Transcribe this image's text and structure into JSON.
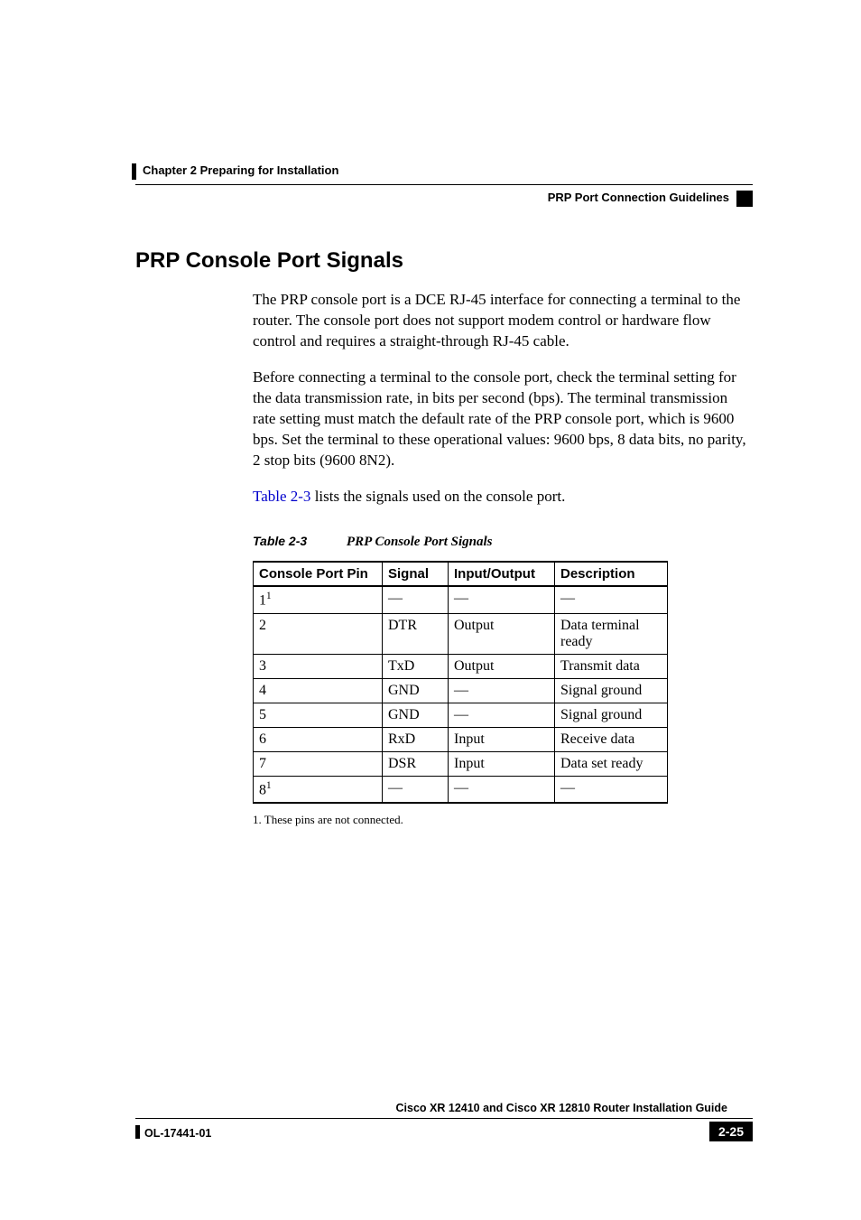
{
  "header": {
    "chapter": "Chapter 2      Preparing for Installation",
    "section": "PRP Port Connection Guidelines"
  },
  "title": "PRP Console Port Signals",
  "paragraphs": {
    "p1": "The PRP console port is a DCE RJ-45 interface for connecting a terminal to the router. The console port does not support modem control or hardware flow control and requires a straight-through RJ-45 cable.",
    "p2": "Before connecting a terminal to the console port, check the terminal setting for the data transmission rate, in bits per second (bps). The terminal transmission rate setting must match the default rate of the PRP console port, which is 9600 bps. Set the terminal to these operational values: 9600 bps, 8 data bits, no parity, 2 stop bits (9600 8N2).",
    "p3a": "Table 2-3",
    "p3b": " lists the signals used on the console port."
  },
  "table": {
    "caption_ref": "Table 2-3",
    "caption_title": "PRP Console Port Signals",
    "headers": {
      "c1": "Console Port Pin",
      "c2": "Signal",
      "c3": "Input/Output",
      "c4": "Description"
    },
    "rows": [
      {
        "pin": "1",
        "sup": "1",
        "signal": "—",
        "io": "—",
        "desc": "—"
      },
      {
        "pin": "2",
        "sup": "",
        "signal": "DTR",
        "io": "Output",
        "desc": "Data terminal ready"
      },
      {
        "pin": "3",
        "sup": "",
        "signal": "TxD",
        "io": "Output",
        "desc": "Transmit data"
      },
      {
        "pin": "4",
        "sup": "",
        "signal": "GND",
        "io": "—",
        "desc": "Signal ground"
      },
      {
        "pin": "5",
        "sup": "",
        "signal": "GND",
        "io": "—",
        "desc": "Signal ground"
      },
      {
        "pin": "6",
        "sup": "",
        "signal": "RxD",
        "io": "Input",
        "desc": "Receive data"
      },
      {
        "pin": "7",
        "sup": "",
        "signal": "DSR",
        "io": "Input",
        "desc": "Data set ready"
      },
      {
        "pin": "8",
        "sup": "1",
        "signal": "—",
        "io": "—",
        "desc": "—"
      }
    ],
    "footnote": "1.   These pins are not connected."
  },
  "footer": {
    "book": "Cisco XR 12410 and Cisco XR 12810 Router Installation Guide",
    "docnum": "OL-17441-01",
    "pagenum": "2-25"
  }
}
